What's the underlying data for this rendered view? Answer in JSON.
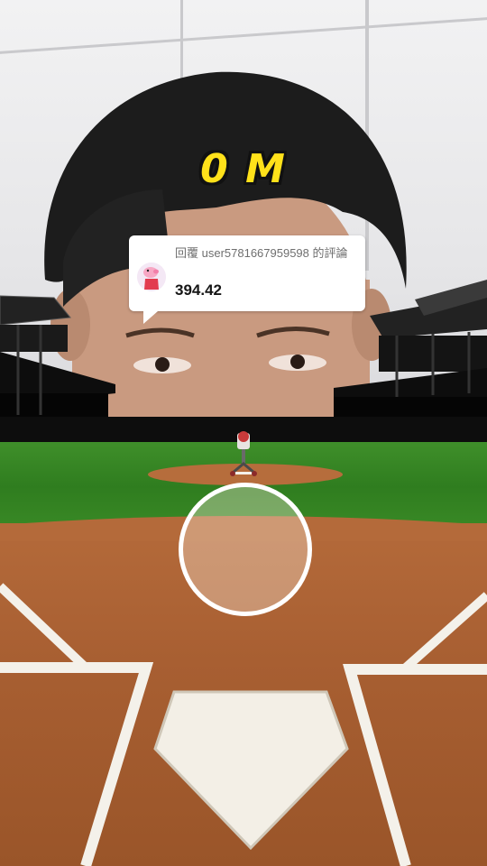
{
  "game": {
    "distance_label": "0 M"
  },
  "reply_card": {
    "label": "回覆 user5781667959598 的評論",
    "value": "394.42",
    "avatar": "pig-character-avatar"
  },
  "colors": {
    "score_yellow": "#ffe11a",
    "grass_green": "#3f8f2a",
    "dirt_brown": "#b46a3a",
    "chalk_white": "#f4f1ea"
  }
}
